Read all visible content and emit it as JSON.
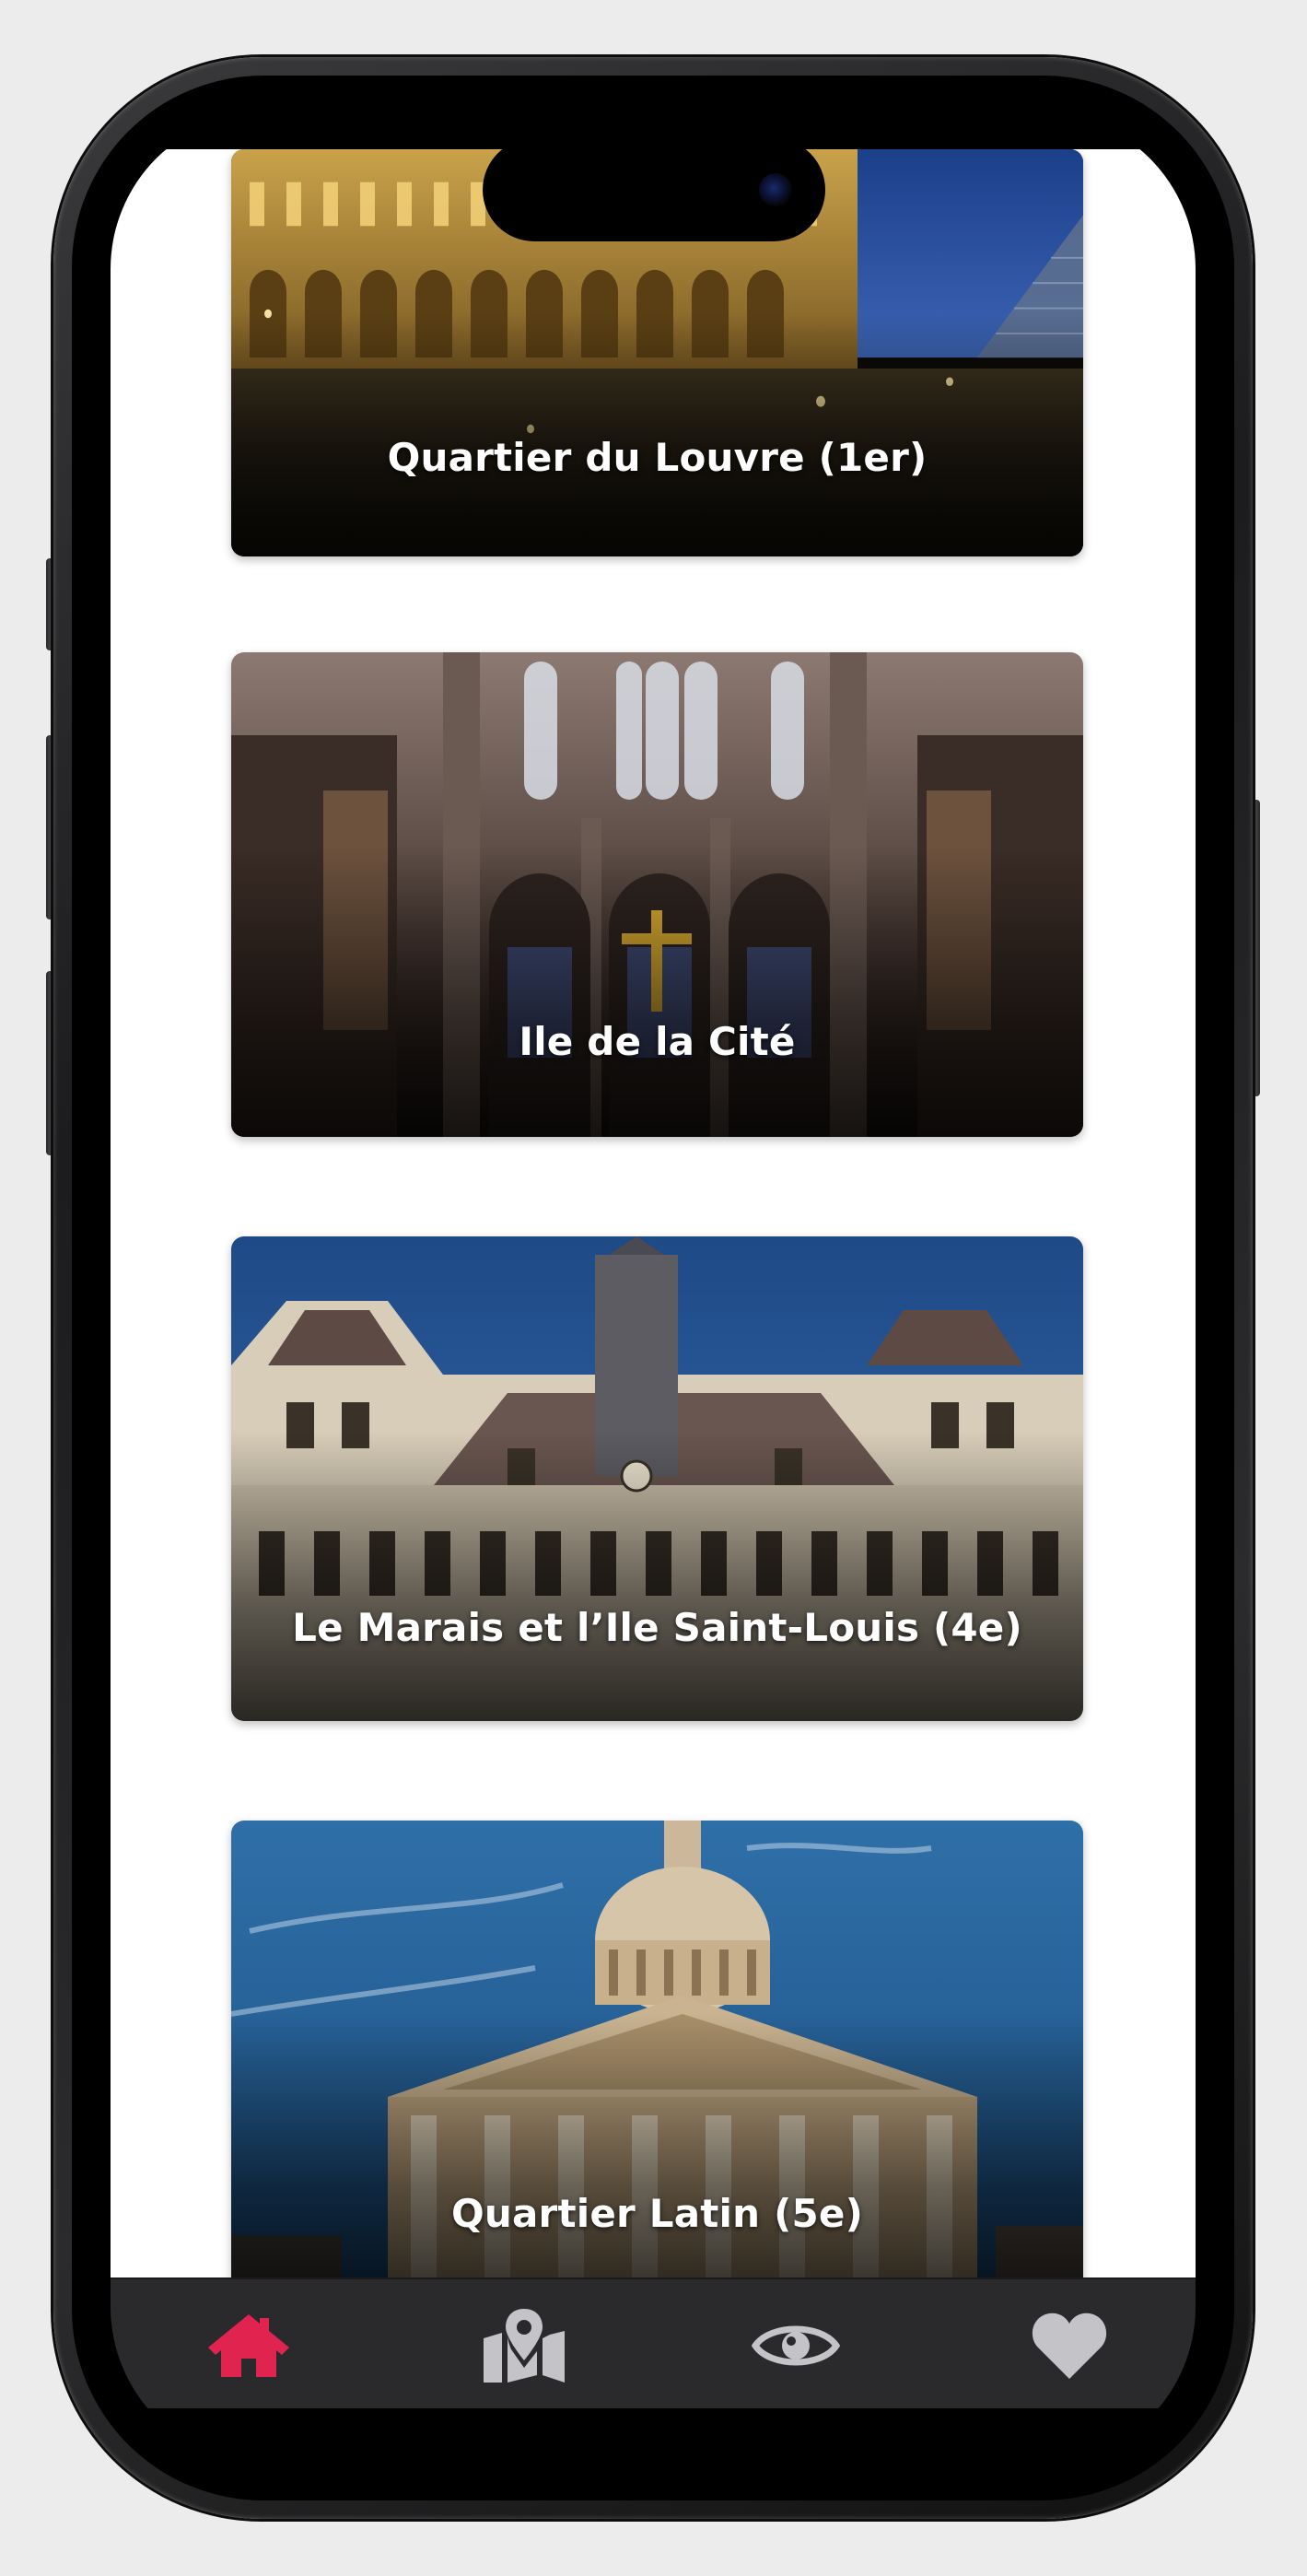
{
  "neighborhoods": [
    {
      "name": "Quartier du Louvre (1er)"
    },
    {
      "name": "Ile de la Cité"
    },
    {
      "name": "Le Marais et l’Ile Saint-Louis (4e)"
    },
    {
      "name": "Quartier Latin (5e)"
    }
  ],
  "tabbar": {
    "tabs": [
      {
        "icon": "home-icon",
        "active": true
      },
      {
        "icon": "map-location-icon",
        "active": false
      },
      {
        "icon": "eye-icon",
        "active": false
      },
      {
        "icon": "heart-icon",
        "active": false
      }
    ],
    "active_color": "#e0244f",
    "inactive_color": "#c4c4c8"
  }
}
